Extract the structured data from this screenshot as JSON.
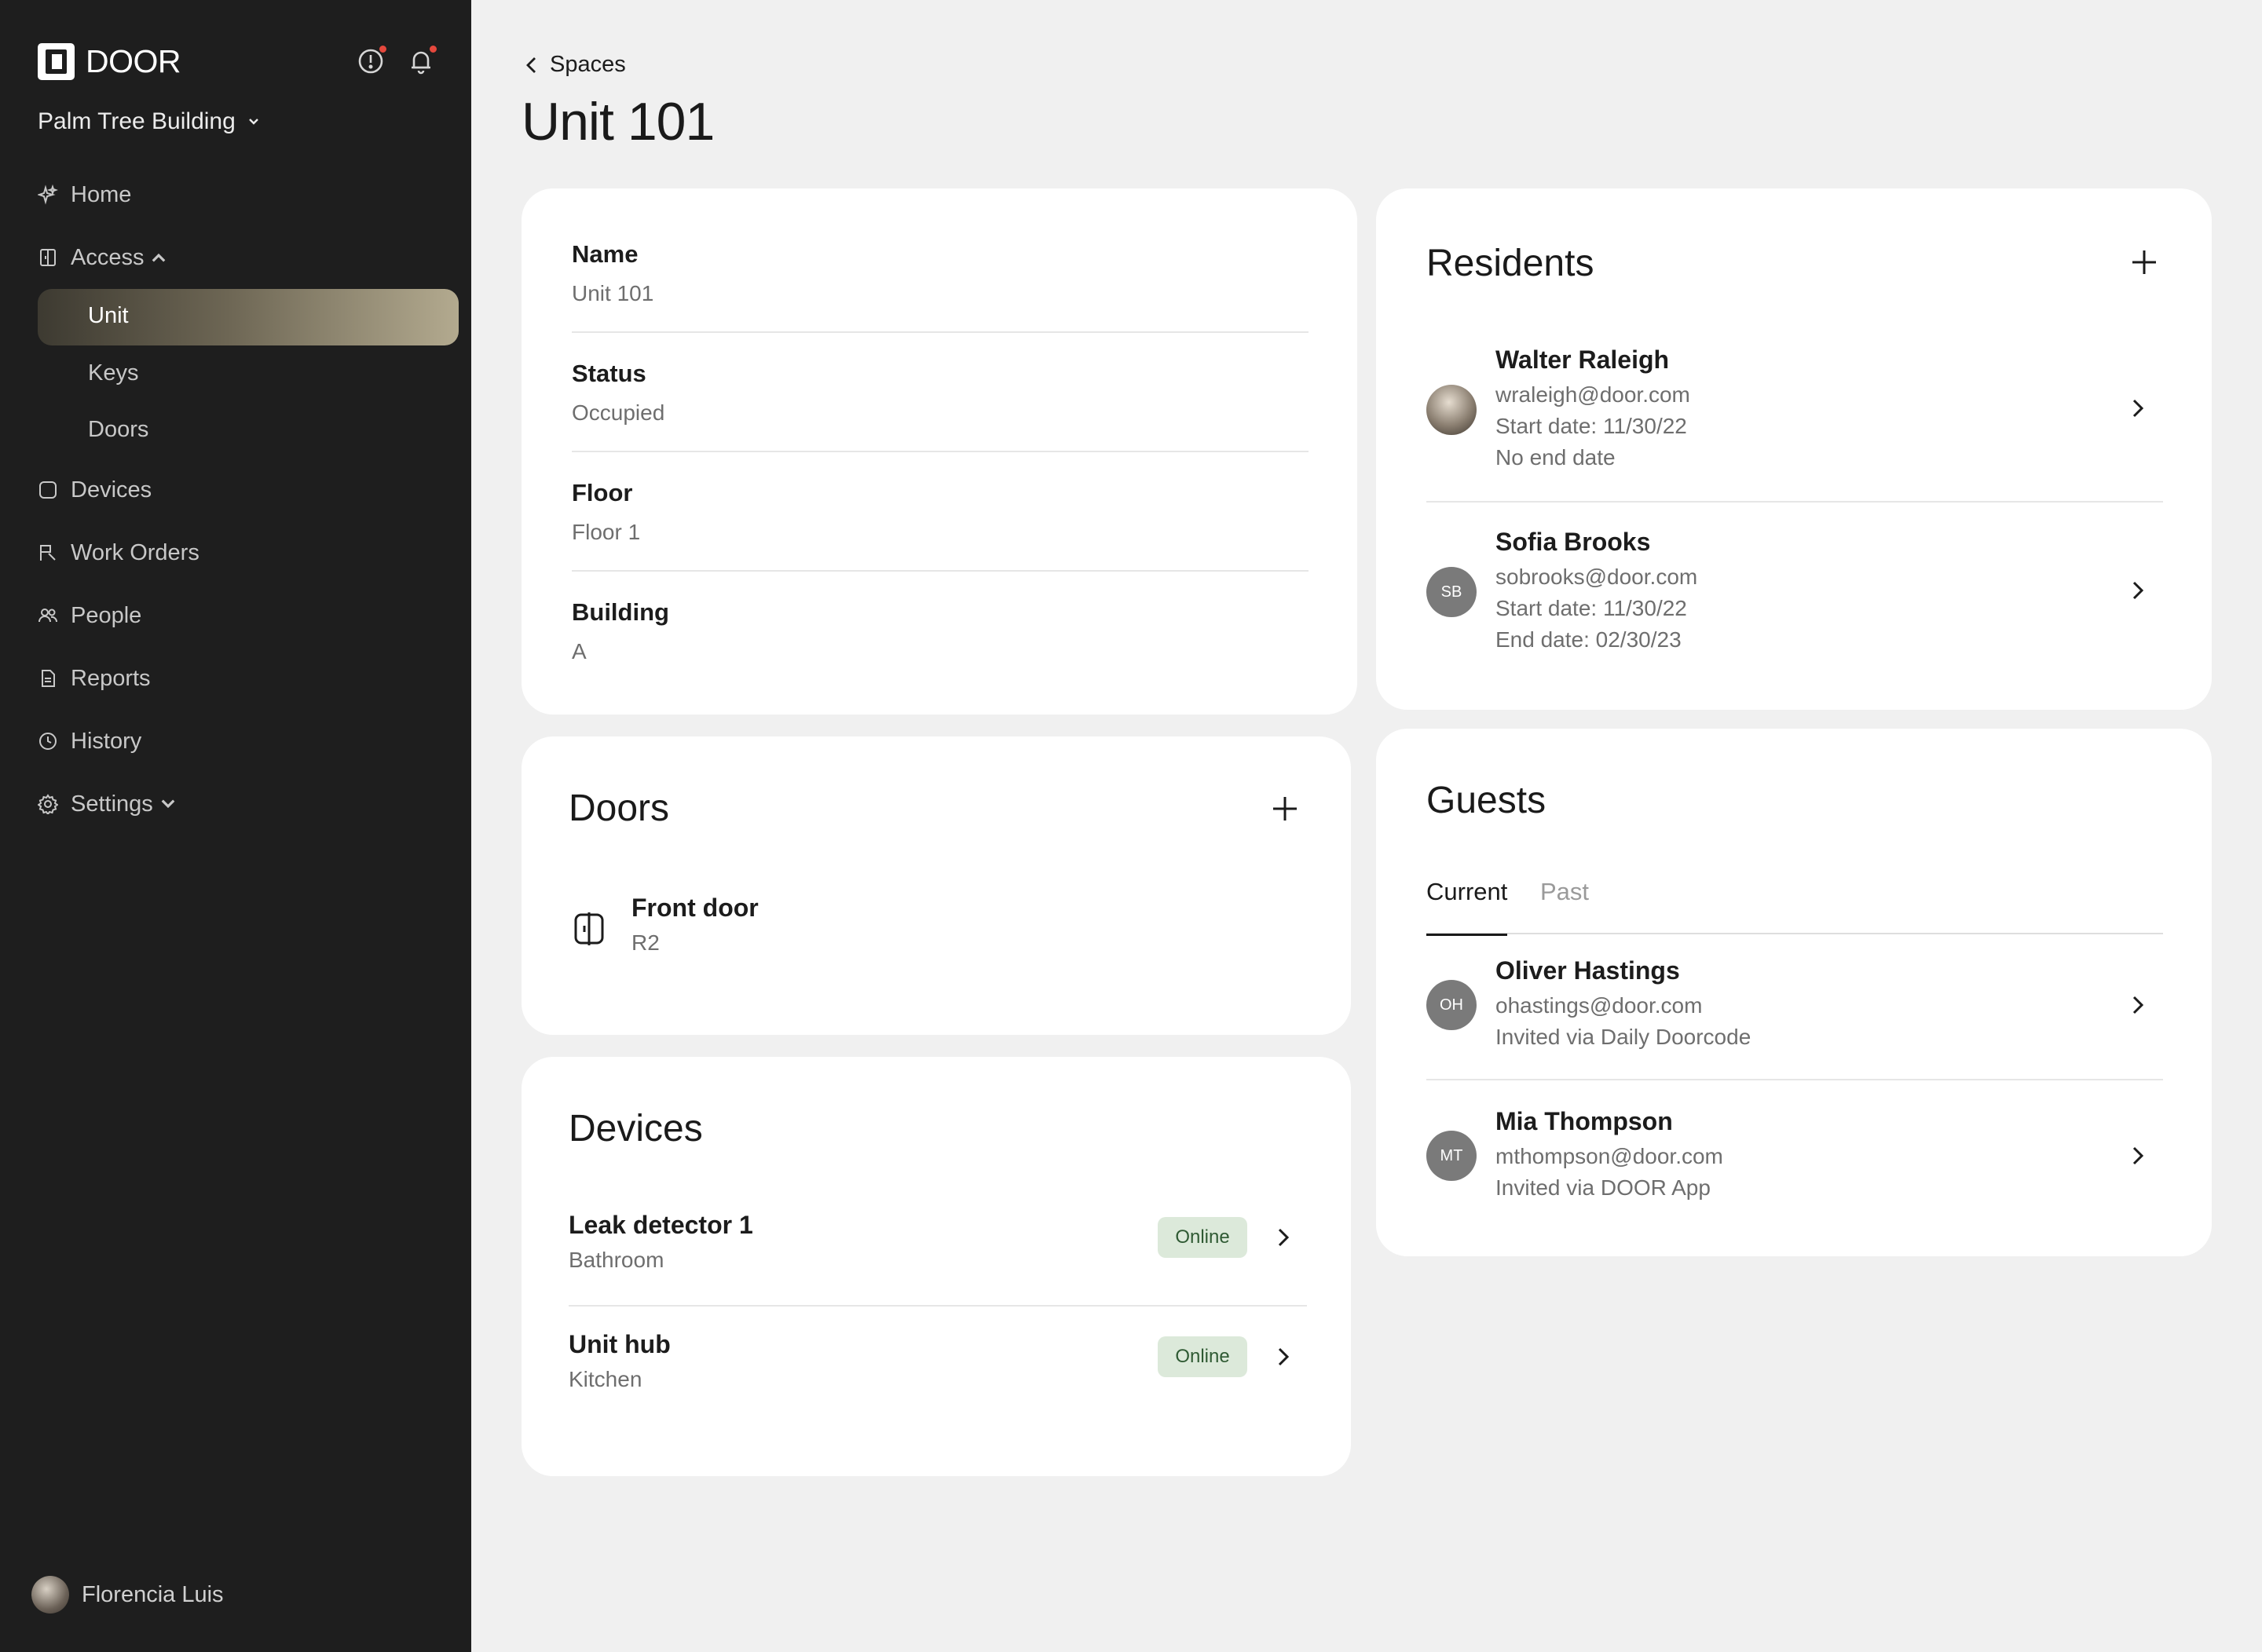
{
  "sidebar": {
    "brand": "DOOR",
    "building": "Palm Tree Building",
    "nav": {
      "home": "Home",
      "access": "Access",
      "unit": "Unit",
      "keys": "Keys",
      "doors": "Doors",
      "devices": "Devices",
      "work_orders": "Work Orders",
      "people": "People",
      "reports": "Reports",
      "history": "History",
      "settings": "Settings"
    },
    "user": "Florencia Luis"
  },
  "header": {
    "breadcrumb": "Spaces",
    "title": "Unit 101"
  },
  "details": [
    {
      "label": "Name",
      "value": "Unit 101"
    },
    {
      "label": "Status",
      "value": "Occupied"
    },
    {
      "label": "Floor",
      "value": "Floor 1"
    },
    {
      "label": "Building",
      "value": "A"
    }
  ],
  "doors": {
    "title": "Doors",
    "items": [
      {
        "name": "Front door",
        "sub": "R2"
      }
    ]
  },
  "devices": {
    "title": "Devices",
    "items": [
      {
        "name": "Leak detector 1",
        "sub": "Bathroom",
        "status": "Online"
      },
      {
        "name": "Unit hub",
        "sub": "Kitchen",
        "status": "Online"
      }
    ]
  },
  "residents": {
    "title": "Residents",
    "items": [
      {
        "name": "Walter Raleigh",
        "email": "wraleigh@door.com",
        "start": "Start date: 11/30/22",
        "end": "No end date"
      },
      {
        "name": "Sofia Brooks",
        "initials": "SB",
        "email": "sobrooks@door.com",
        "start": "Start date: 11/30/22",
        "end": "End date: 02/30/23"
      }
    ]
  },
  "guests": {
    "title": "Guests",
    "tabs": [
      "Current",
      "Past"
    ],
    "items": [
      {
        "name": "Oliver Hastings",
        "initials": "OH",
        "email": "ohastings@door.com",
        "via": "Invited via Daily Doorcode"
      },
      {
        "name": "Mia Thompson",
        "initials": "MT",
        "email": "mthompson@door.com",
        "via": "Invited via DOOR App"
      }
    ]
  },
  "colors": {
    "sidebar_bg": "#1e1e1e",
    "page_bg": "#f0f0f0",
    "online_badge_bg": "#dce9da",
    "notification_dot": "#e5483d"
  }
}
